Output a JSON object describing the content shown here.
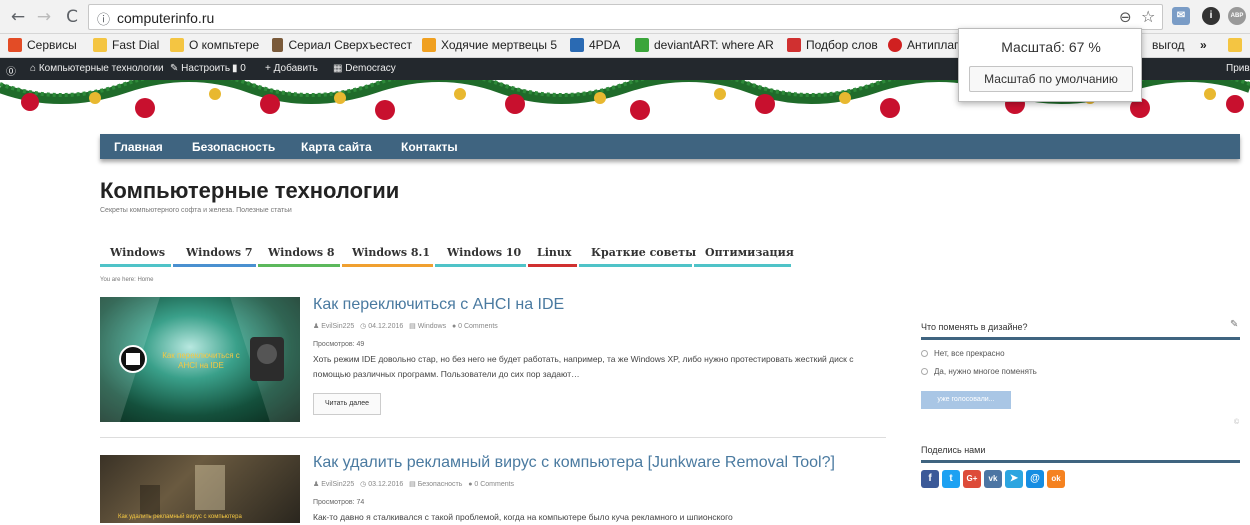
{
  "browser": {
    "url": "computerinfo.ru",
    "bookmarks": [
      {
        "label": "Сервисы",
        "color": "#e34c26"
      },
      {
        "label": "Fast Dial",
        "color": "#f4c542"
      },
      {
        "label": "О компьтере",
        "color": "#f4c542"
      },
      {
        "label": "Сериал Сверхъестест",
        "color": "#7a5a3a"
      },
      {
        "label": "Ходячие мертвецы 5",
        "color": "#f0a020"
      },
      {
        "label": "4PDA",
        "color": "#2a6ab3"
      },
      {
        "label": "deviantART: where AR",
        "color": "#3aa53a"
      },
      {
        "label": "Подбор слов",
        "color": "#d03030"
      },
      {
        "label": "Антиплаг",
        "color": "#d02020"
      },
      {
        "label": "выгод",
        "color": "#f4c542"
      }
    ],
    "more": "»"
  },
  "zoom_popup": {
    "title": "Масштаб: 67 %",
    "reset_label": "Масштаб по умолчанию"
  },
  "wpbar": {
    "site": "Компьютерные технологии",
    "customize": "Настроить",
    "comments": "0",
    "add": "Добавить",
    "theme": "Democracy",
    "right": "Прив"
  },
  "nav": [
    "Главная",
    "Безопасность",
    "Карта сайта",
    "Контакты"
  ],
  "site": {
    "title": "Компьютерные технологии",
    "description": "Секреты компьютерного софта и железа. Полезные статьи"
  },
  "categories": [
    {
      "label": "Windows",
      "color": "#4fc3c8"
    },
    {
      "label": "Windows 7",
      "color": "#4a90d0"
    },
    {
      "label": "Windows 8",
      "color": "#5cb85c"
    },
    {
      "label": "Windows 8.1",
      "color": "#f0a030"
    },
    {
      "label": "Windows 10",
      "color": "#4fc3c8"
    },
    {
      "label": "Linux",
      "color": "#d03030"
    },
    {
      "label": "Краткие советы",
      "color": "#4fc3c8"
    },
    {
      "label": "Оптимизация",
      "color": "#4fc3c8"
    }
  ],
  "breadcrumbs": "You are here: Home",
  "posts": [
    {
      "title": "Как переключиться с AHCI на IDE",
      "author": "EvilSin225",
      "date": "04.12.2016",
      "category": "Windows",
      "comments": "0 Comments",
      "views": "Просмотров: 49",
      "excerpt": "Хоть режим IDE довольно стар, но без него не будет работать, например, та же Windows XP, либо нужно протестировать жесткий диск с помощью различных программ. Пользователи до сих пор задают…",
      "thumb_text": "Как переключиться с AHCI на IDE",
      "readmore": "Читать далее"
    },
    {
      "title": "Как удалить рекламный вирус с компьютера [Junkware Removal Tool?]",
      "author": "EvilSin225",
      "date": "03.12.2016",
      "category": "Безопасность",
      "comments": "0 Comments",
      "views": "Просмотров: 74",
      "excerpt": "Как-то давно я сталкивался с такой проблемой, когда на компьютере было куча рекламного и шпионского",
      "thumb_text": "Как удалить рекламный вирус с компьютера"
    }
  ],
  "sidebar": {
    "poll_title": "Что поменять в дизайне?",
    "options": [
      "Нет, все прекрасно",
      "Да, нужно многое поменять"
    ],
    "vote_label": "уже голосовали...",
    "share_title": "Поделись нами",
    "share": [
      {
        "icon": "f",
        "color": "#3b5998"
      },
      {
        "icon": "t",
        "color": "#1da1f2"
      },
      {
        "icon": "G+",
        "color": "#dd4b39"
      },
      {
        "icon": "vk",
        "color": "#4c75a3"
      },
      {
        "icon": "➤",
        "color": "#2ca5e0"
      },
      {
        "icon": "@",
        "color": "#168de2"
      },
      {
        "icon": "ok",
        "color": "#f58220"
      }
    ]
  }
}
